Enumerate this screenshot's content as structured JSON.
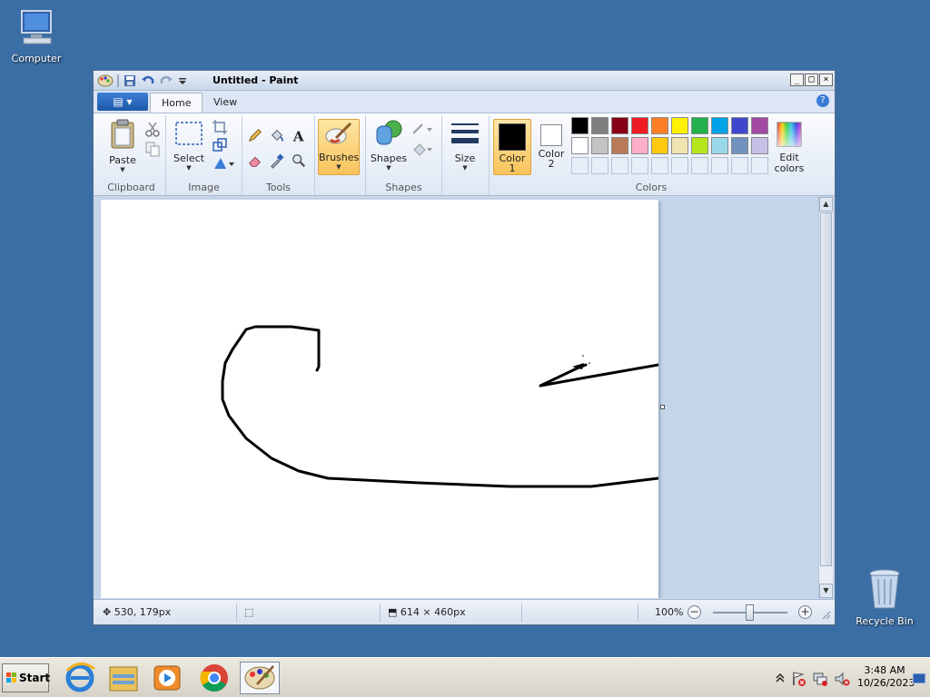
{
  "desktop": {
    "computer_label": "Computer",
    "recycle_label": "Recycle Bin"
  },
  "window": {
    "title": "Untitled - Paint"
  },
  "tabs": {
    "home": "Home",
    "view": "View"
  },
  "ribbon": {
    "clipboard": {
      "paste": "Paste",
      "label": "Clipboard"
    },
    "image": {
      "select": "Select",
      "label": "Image"
    },
    "tools": {
      "label": "Tools"
    },
    "brushes": {
      "label": "Brushes"
    },
    "shapes": {
      "shapes_btn": "Shapes",
      "label": "Shapes"
    },
    "size": {
      "label": "Size"
    },
    "colors": {
      "color1": "Color",
      "color1_num": "1",
      "color2": "Color",
      "color2_num": "2",
      "edit_colors_line1": "Edit",
      "edit_colors_line2": "colors",
      "label": "Colors",
      "palette_row1": [
        "#000000",
        "#7f7f7f",
        "#880015",
        "#ed1c24",
        "#ff7f27",
        "#fff200",
        "#22b14c",
        "#00a2e8",
        "#3f48cc",
        "#a349a4"
      ],
      "palette_row2": [
        "#ffffff",
        "#c3c3c3",
        "#b97a57",
        "#ffaec9",
        "#ffc90e",
        "#efe4b0",
        "#b5e61d",
        "#99d9ea",
        "#7092be",
        "#c8bfe7"
      ]
    }
  },
  "status": {
    "cursor_pos": "530, 179px",
    "canvas_size": "614 × 460px",
    "zoom": "100%"
  },
  "taskbar": {
    "start": "Start",
    "time": "3:48 AM",
    "date": "10/26/2023"
  }
}
